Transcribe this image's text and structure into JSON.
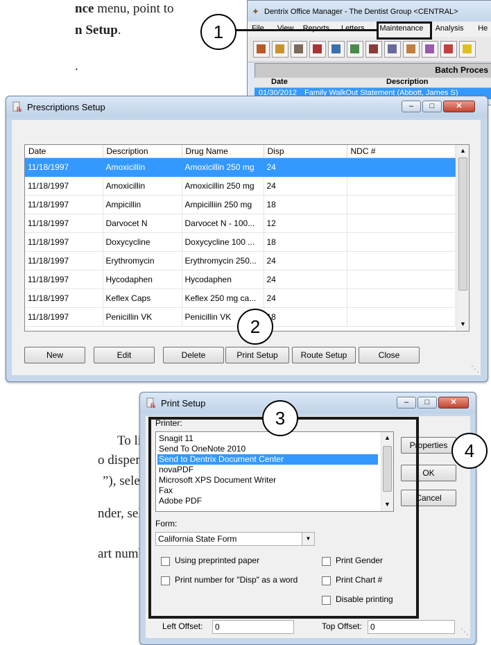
{
  "doc": {
    "line1_bold": "nce",
    "line1_rest": " menu, point to",
    "line2_bold": "n Setup",
    "line2_rest": ".",
    "line3": ".",
    "para_a": "To list the",
    "para_b": "o dispense as a",
    "para_c": "”), select this",
    "para_d": "nder, select this",
    "para_e": "art number,"
  },
  "callouts": {
    "c1": "1",
    "c2": "2",
    "c3": "3",
    "c4": "4"
  },
  "office_manager": {
    "title": "Dentrix Office Manager - The Dentist Group <CENTRAL>",
    "menu": [
      "File",
      "View",
      "Reports",
      "Letters",
      "Maintenance",
      "Analysis",
      "He"
    ],
    "highlighted_menu": "Maintenance",
    "panel_title": "Batch Proces",
    "columns": [
      "Date",
      "Description"
    ],
    "row": {
      "date": "01/30/2012",
      "description": "Family WalkOut Statement (Abbott, James S)"
    }
  },
  "prescriptions_setup": {
    "title": "Prescriptions Setup",
    "columns": [
      "Date",
      "Description",
      "Drug Name",
      "Disp",
      "NDC #"
    ],
    "rows": [
      {
        "date": "11/18/1997",
        "description": "Amoxicillin",
        "drug": "Amoxicillin 250 mg",
        "disp": "24",
        "ndc": ""
      },
      {
        "date": "11/18/1997",
        "description": "Amoxicillin",
        "drug": "Amoxicillin 250 mg",
        "disp": "24",
        "ndc": ""
      },
      {
        "date": "11/18/1997",
        "description": "Ampicillin",
        "drug": "Ampicilliin 250 mg",
        "disp": "18",
        "ndc": ""
      },
      {
        "date": "11/18/1997",
        "description": "Darvocet N",
        "drug": "Darvocet N - 100...",
        "disp": "12",
        "ndc": ""
      },
      {
        "date": "11/18/1997",
        "description": "Doxycycline",
        "drug": "Doxycycline 100 ...",
        "disp": "18",
        "ndc": ""
      },
      {
        "date": "11/18/1997",
        "description": "Erythromycin",
        "drug": "Erythromycin 250...",
        "disp": "24",
        "ndc": ""
      },
      {
        "date": "11/18/1997",
        "description": "Hycodaphen",
        "drug": "Hycodaphen",
        "disp": "24",
        "ndc": ""
      },
      {
        "date": "11/18/1997",
        "description": "Keflex Caps",
        "drug": "Keflex 250 mg ca...",
        "disp": "24",
        "ndc": ""
      },
      {
        "date": "11/18/1997",
        "description": "Penicillin VK",
        "drug": "Penicillin VK",
        "disp": "18",
        "ndc": ""
      }
    ],
    "buttons": {
      "new": "New",
      "edit": "Edit",
      "delete": "Delete",
      "print_setup": "Print Setup",
      "route_setup": "Route Setup",
      "close": "Close"
    }
  },
  "print_setup": {
    "title": "Print Setup",
    "printer_label": "Printer:",
    "printers": [
      "Snagit 11",
      "Send To OneNote 2010",
      "Send to Dentrix Document Center",
      "novaPDF",
      "Microsoft XPS Document Writer",
      "Fax",
      "Adobe PDF"
    ],
    "selected_printer": "Send to Dentrix Document Center",
    "form_label": "Form:",
    "form_value": "California State Form",
    "checkboxes": {
      "preprinted": "Using preprinted paper",
      "disp_word": "Print number for \"Disp\" as a word",
      "gender": "Print Gender",
      "chart": "Print Chart #",
      "disable": "Disable printing"
    },
    "buttons": {
      "properties": "Properties",
      "ok": "OK",
      "cancel": "Cancel"
    },
    "left_offset_label": "Left Offset:",
    "left_offset_value": "0",
    "top_offset_label": "Top Offset:",
    "top_offset_value": "0"
  },
  "colors": {
    "selection": "#3399ff",
    "window_frame": "#c5d7ea"
  }
}
